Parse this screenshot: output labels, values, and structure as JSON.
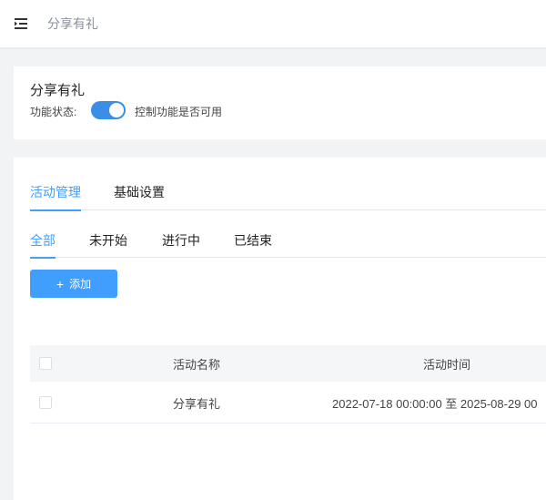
{
  "header": {
    "breadcrumb": "分享有礼"
  },
  "feature": {
    "title": "分享有礼",
    "status_label": "功能状态:",
    "switch_on": true,
    "status_desc": "控制功能是否可用"
  },
  "tabs": {
    "primary": [
      {
        "label": "活动管理",
        "active": true
      },
      {
        "label": "基础设置",
        "active": false
      }
    ],
    "secondary": [
      {
        "label": "全部",
        "active": true
      },
      {
        "label": "未开始",
        "active": false
      },
      {
        "label": "进行中",
        "active": false
      },
      {
        "label": "已结束",
        "active": false
      }
    ]
  },
  "toolbar": {
    "add_label": "添加"
  },
  "table": {
    "columns": [
      "活动名称",
      "活动时间"
    ],
    "rows": [
      {
        "name": "分享有礼",
        "time": "2022-07-18 00:00:00 至 2025-08-29 00"
      }
    ]
  },
  "colors": {
    "accent": "#409eff",
    "switch": "#3a8ee6"
  }
}
